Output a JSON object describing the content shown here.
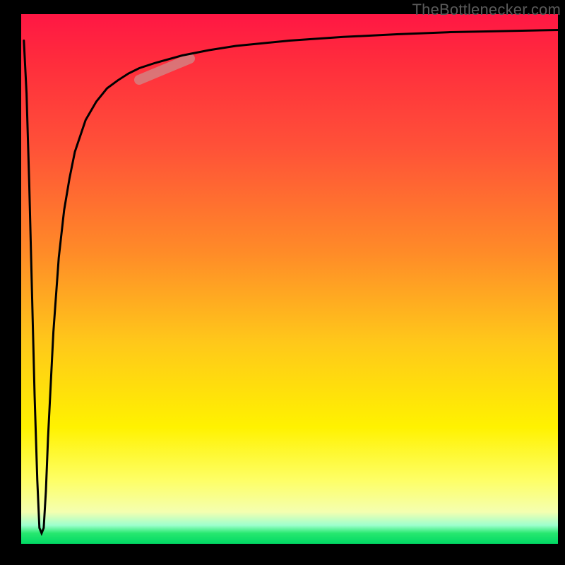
{
  "watermark": "TheBottlenecker.com",
  "colors": {
    "gradient_top": "#ff1744",
    "gradient_mid1": "#ff8b28",
    "gradient_mid2": "#fff200",
    "gradient_bottom": "#00d964",
    "curve": "#000000",
    "highlight": "#d08a8a",
    "frame": "#000000"
  },
  "chart_data": {
    "type": "line",
    "title": "",
    "xlabel": "",
    "ylabel": "",
    "xlim": [
      0,
      100
    ],
    "ylim": [
      0,
      100
    ],
    "annotations": [
      {
        "name": "highlight-segment",
        "x_start": 22,
        "x_end": 31,
        "note": "thick pink/brown overlay on curve"
      }
    ],
    "series": [
      {
        "name": "curve",
        "description": "Starts near top-left, plunges sharply to bottom at small x (~3-4% of width), then rises steeply and asymptotically approaches the top as x increases.",
        "x": [
          0.5,
          1.0,
          1.5,
          2.0,
          2.5,
          3.0,
          3.4,
          3.8,
          4.2,
          4.6,
          5.0,
          6.0,
          7.0,
          8.0,
          9.0,
          10,
          12,
          14,
          16,
          18,
          20,
          22,
          25,
          30,
          35,
          40,
          50,
          60,
          70,
          80,
          90,
          100
        ],
        "y": [
          95,
          85,
          68,
          48,
          28,
          12,
          3,
          2,
          3,
          10,
          20,
          40,
          54,
          63,
          69,
          74,
          80,
          83.5,
          86,
          87.5,
          88.8,
          89.8,
          90.8,
          92.2,
          93.2,
          94.0,
          95.0,
          95.7,
          96.2,
          96.6,
          96.8,
          97.0
        ]
      }
    ]
  }
}
